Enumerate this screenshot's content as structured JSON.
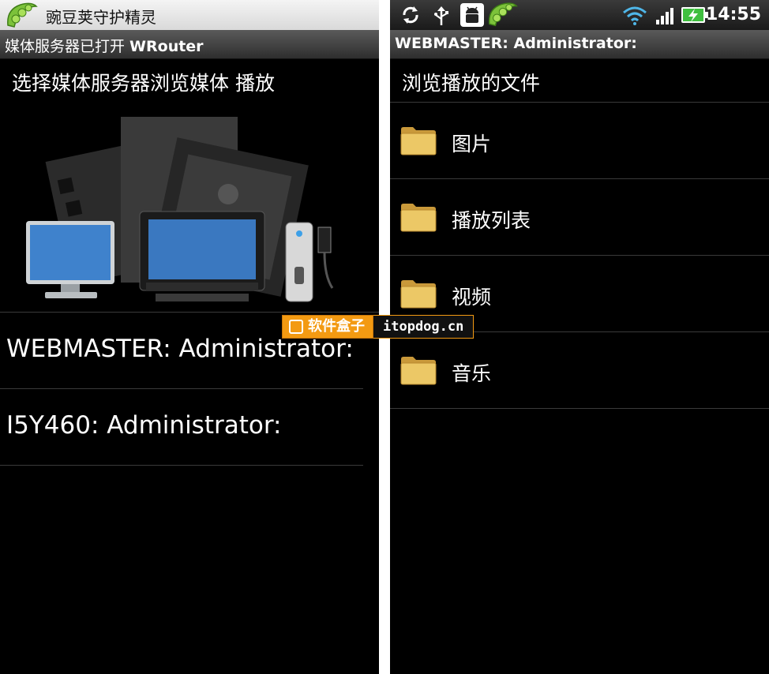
{
  "left": {
    "notification_title": "豌豆荚守护精灵",
    "titlebar_prefix": "媒体服务器已打开 ",
    "titlebar_app": "WRouter",
    "section_heading": "选择媒体服务器浏览媒体 播放",
    "servers": [
      {
        "label": "WEBMASTER: Administrator:"
      },
      {
        "label": "I5Y460: Administrator:"
      }
    ]
  },
  "right": {
    "status": {
      "time": "14:55",
      "icons": [
        "sync-icon",
        "usb-icon",
        "android-debug-icon",
        "wandoujia-pea-icon",
        "wifi-icon",
        "signal-icon",
        "battery-charging-icon"
      ]
    },
    "titlebar": "WEBMASTER: Administrator:",
    "section_heading": "浏览播放的文件",
    "folders": [
      {
        "label": "图片"
      },
      {
        "label": "播放列表"
      },
      {
        "label": "视频"
      },
      {
        "label": "音乐"
      }
    ]
  },
  "watermark": {
    "brand": "软件盒子",
    "site": "itopdog.cn"
  },
  "colors": {
    "background": "#000000",
    "divider": "#3a3a3a",
    "watermark_orange": "#f39a12",
    "folder_yellow": "#e8c15a"
  }
}
